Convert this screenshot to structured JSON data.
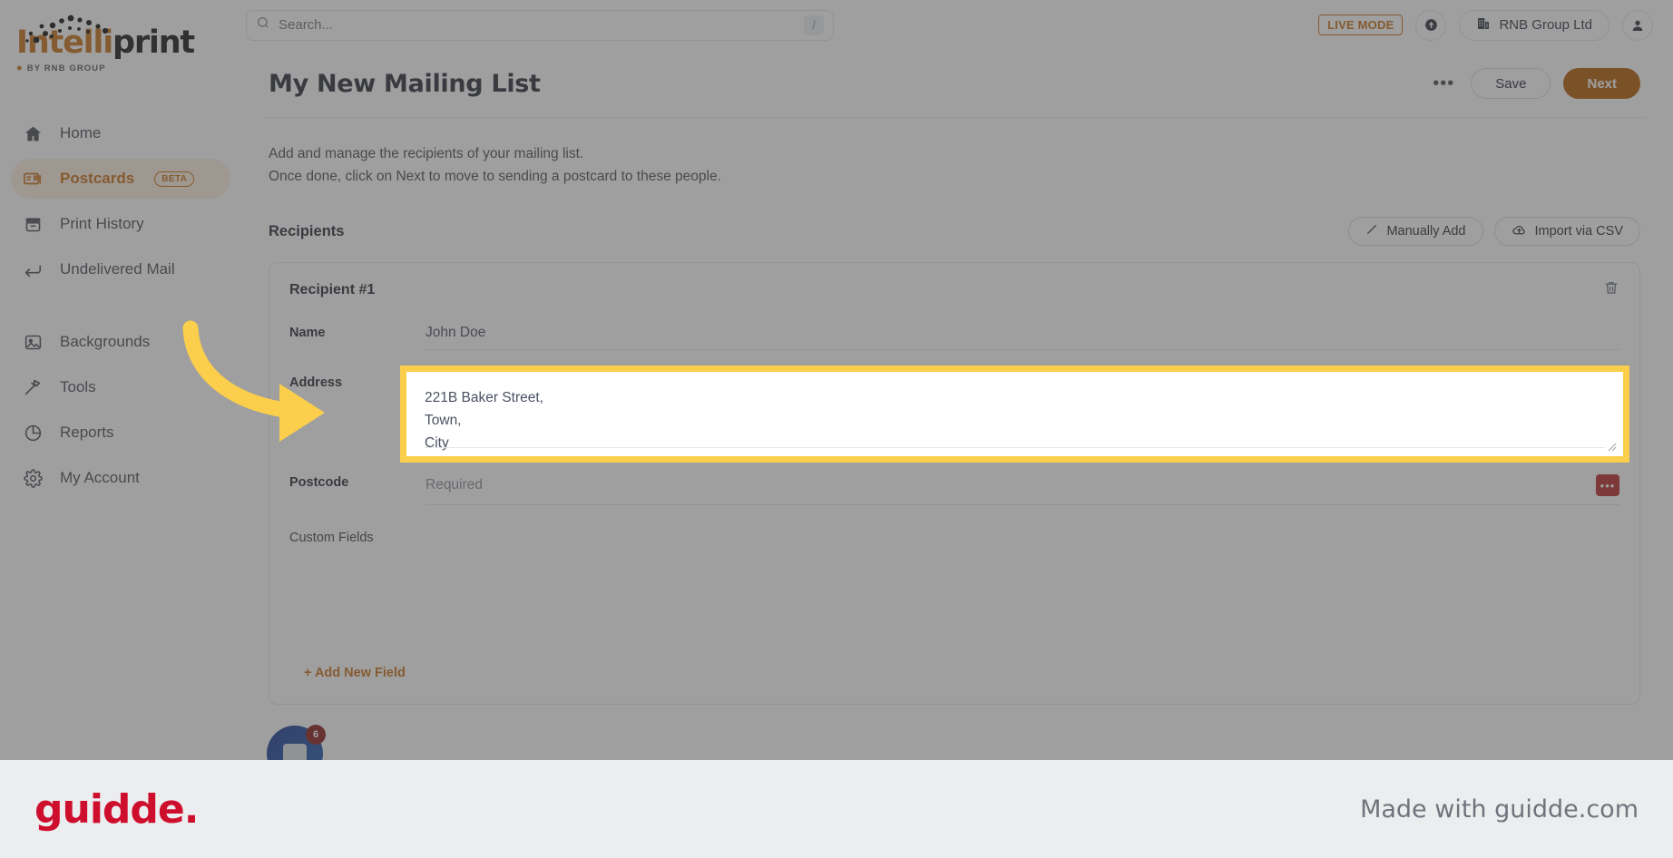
{
  "brand": {
    "logo_primary": "Intelli",
    "logo_secondary": "print",
    "logo_sub": "BY RNB GROUP",
    "accent_color": "#C87119",
    "next_button_color": "#B35C07",
    "highlight_color": "#FBCF4B"
  },
  "sidebar": {
    "items": [
      {
        "label": "Home",
        "icon": "home-icon",
        "badge": "",
        "active": false
      },
      {
        "label": "Postcards",
        "icon": "postcard-icon",
        "badge": "BETA",
        "active": true
      },
      {
        "label": "Print History",
        "icon": "archive-icon",
        "badge": "",
        "active": false
      },
      {
        "label": "Undelivered Mail",
        "icon": "return-arrow-icon",
        "badge": "",
        "active": false
      },
      {
        "label": "Backgrounds",
        "icon": "image-icon",
        "badge": "",
        "active": false
      },
      {
        "label": "Tools",
        "icon": "hammer-icon",
        "badge": "",
        "active": false
      },
      {
        "label": "Reports",
        "icon": "pie-chart-icon",
        "badge": "",
        "active": false
      },
      {
        "label": "My Account",
        "icon": "gear-icon",
        "badge": "",
        "active": false
      }
    ]
  },
  "topbar": {
    "search_placeholder": "Search...",
    "search_value": "",
    "shortcut_key": "/",
    "live_mode": "LIVE MODE",
    "org_name": "RNB Group Ltd"
  },
  "page": {
    "title": "My New Mailing List",
    "more_label": "•••",
    "save_label": "Save",
    "next_label": "Next",
    "description_line1": "Add and manage the recipients of your mailing list.",
    "description_line2": "Once done, click on Next to move to sending a postcard to these people."
  },
  "recipients_section": {
    "title": "Recipients",
    "manually_add_label": "Manually Add",
    "import_csv_label": "Import via CSV"
  },
  "recipient": {
    "card_title": "Recipient #1",
    "name_label": "Name",
    "name_value": "John Doe",
    "address_label": "Address",
    "address_lines": [
      "221B Baker Street,",
      "Town,",
      "City"
    ],
    "postcode_label": "Postcode",
    "postcode_placeholder": "Required",
    "postcode_more": "•••",
    "custom_fields_label": "Custom Fields",
    "add_new_field_label": "+ Add New Field"
  },
  "chat": {
    "unread_count": "6"
  },
  "footer": {
    "logo": "guidde.",
    "made_with": "Made with guidde.com"
  }
}
